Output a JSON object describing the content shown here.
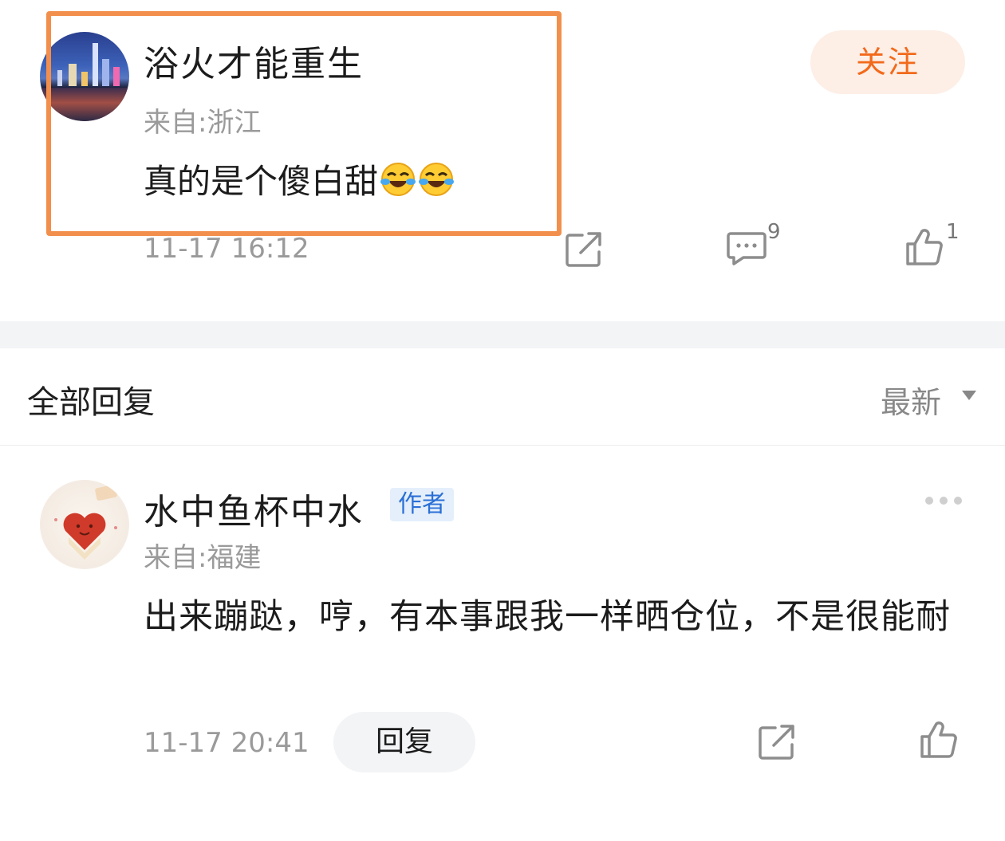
{
  "comment": {
    "username": "浴火才能重生",
    "origin": "来自:浙江",
    "text": "真的是个傻白甜",
    "emoji": [
      "laughing-crying-emoji",
      "laughing-crying-emoji"
    ],
    "timestamp": "11-17 16:12",
    "follow_label": "关注",
    "reply_count": "9",
    "like_count": "1"
  },
  "replies_header": {
    "title": "全部回复",
    "sort": "最新"
  },
  "reply": {
    "username": "水中鱼杯中水",
    "badge": "作者",
    "origin": "来自:福建",
    "text": "出来蹦跶，哼，有本事跟我一样晒仓位，不是很能耐",
    "timestamp": "11-17 20:41",
    "reply_label": "回复"
  },
  "colors": {
    "accent": "#f26a1b",
    "follow_bg": "#fdeee6",
    "highlight": "#f28f4d",
    "badge_text": "#2b6fd6",
    "badge_bg": "#e4effb"
  }
}
